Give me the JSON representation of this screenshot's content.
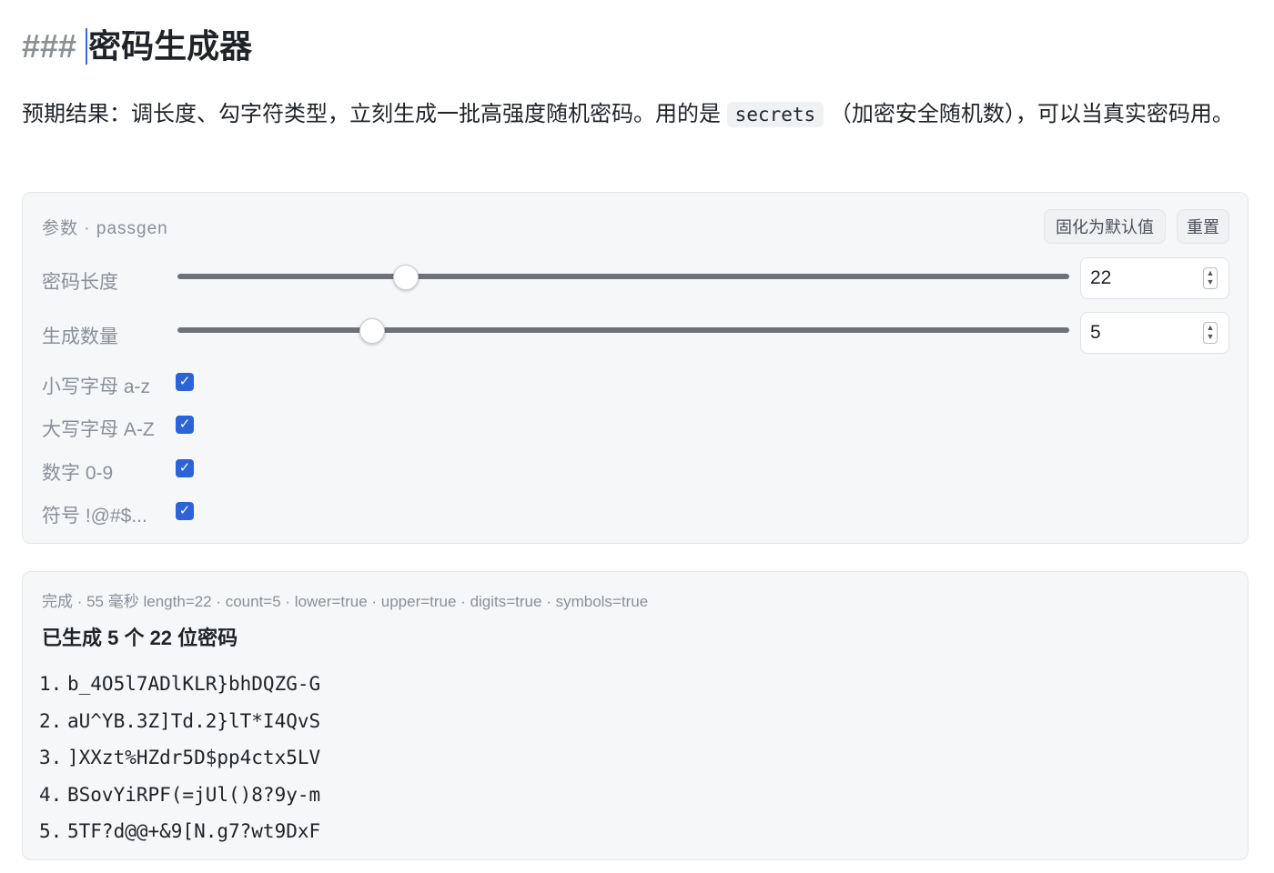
{
  "heading": {
    "prefix": "###",
    "title": "密码生成器"
  },
  "description": {
    "before": "预期结果：调长度、勾字符类型，立刻生成一批高强度随机密码。用的是 ",
    "code": "secrets",
    "after": " （加密安全随机数），可以当真实密码用。"
  },
  "params": {
    "title": "参数 · passgen",
    "buttons": {
      "set_default": "固化为默认值",
      "reset": "重置"
    },
    "length": {
      "label": "密码长度",
      "value": "22",
      "slider_fraction": 0.255
    },
    "count": {
      "label": "生成数量",
      "value": "5",
      "slider_fraction": 0.217
    },
    "checkboxes": [
      {
        "label": "小写字母 a-z",
        "checked": true
      },
      {
        "label": "大写字母 A-Z",
        "checked": true
      },
      {
        "label": "数字 0-9",
        "checked": true
      },
      {
        "label": "符号 !@#$...",
        "checked": true
      }
    ]
  },
  "result": {
    "meta": "完成 · 55 毫秒  length=22 · count=5 · lower=true · upper=true · digits=true · symbols=true",
    "title": "已生成 5 个 22 位密码",
    "passwords": [
      {
        "num": "1.",
        "value": "b_4O5l7ADlKLR}bhDQZG-G"
      },
      {
        "num": "2.",
        "value": "aU^YB.3Z]Td.2}lT*I4QvS"
      },
      {
        "num": "3.",
        "value": "]XXzt%HZdr5D$pp4ctx5LV"
      },
      {
        "num": "4.",
        "value": "BSovYiRPF(=jUl()8?9y-m"
      },
      {
        "num": "5.",
        "value": "5TF?d@@+&9[N.g7?wt9DxF"
      }
    ]
  },
  "colors": {
    "accent": "#2d63d8",
    "panel_bg": "#f6f7f8",
    "muted_text": "#8a9099"
  }
}
